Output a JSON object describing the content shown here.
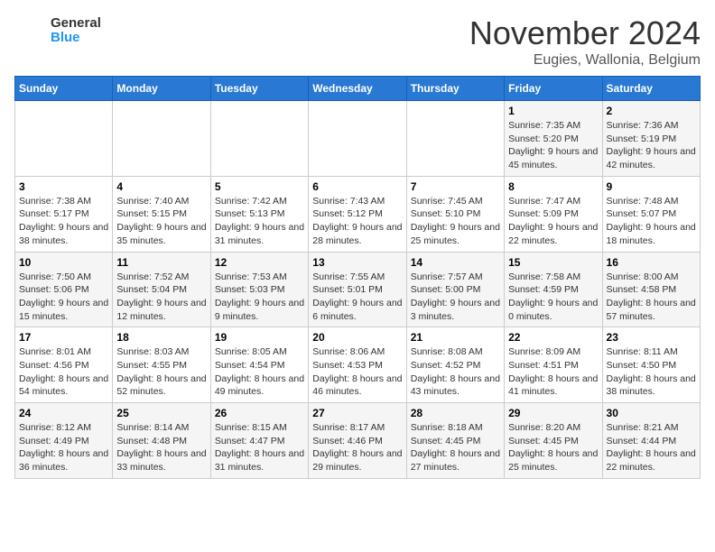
{
  "logo": {
    "line1": "General",
    "line2": "Blue"
  },
  "title": "November 2024",
  "subtitle": "Eugies, Wallonia, Belgium",
  "days_of_week": [
    "Sunday",
    "Monday",
    "Tuesday",
    "Wednesday",
    "Thursday",
    "Friday",
    "Saturday"
  ],
  "weeks": [
    [
      {
        "day": "",
        "info": ""
      },
      {
        "day": "",
        "info": ""
      },
      {
        "day": "",
        "info": ""
      },
      {
        "day": "",
        "info": ""
      },
      {
        "day": "",
        "info": ""
      },
      {
        "day": "1",
        "info": "Sunrise: 7:35 AM\nSunset: 5:20 PM\nDaylight: 9 hours and 45 minutes."
      },
      {
        "day": "2",
        "info": "Sunrise: 7:36 AM\nSunset: 5:19 PM\nDaylight: 9 hours and 42 minutes."
      }
    ],
    [
      {
        "day": "3",
        "info": "Sunrise: 7:38 AM\nSunset: 5:17 PM\nDaylight: 9 hours and 38 minutes."
      },
      {
        "day": "4",
        "info": "Sunrise: 7:40 AM\nSunset: 5:15 PM\nDaylight: 9 hours and 35 minutes."
      },
      {
        "day": "5",
        "info": "Sunrise: 7:42 AM\nSunset: 5:13 PM\nDaylight: 9 hours and 31 minutes."
      },
      {
        "day": "6",
        "info": "Sunrise: 7:43 AM\nSunset: 5:12 PM\nDaylight: 9 hours and 28 minutes."
      },
      {
        "day": "7",
        "info": "Sunrise: 7:45 AM\nSunset: 5:10 PM\nDaylight: 9 hours and 25 minutes."
      },
      {
        "day": "8",
        "info": "Sunrise: 7:47 AM\nSunset: 5:09 PM\nDaylight: 9 hours and 22 minutes."
      },
      {
        "day": "9",
        "info": "Sunrise: 7:48 AM\nSunset: 5:07 PM\nDaylight: 9 hours and 18 minutes."
      }
    ],
    [
      {
        "day": "10",
        "info": "Sunrise: 7:50 AM\nSunset: 5:06 PM\nDaylight: 9 hours and 15 minutes."
      },
      {
        "day": "11",
        "info": "Sunrise: 7:52 AM\nSunset: 5:04 PM\nDaylight: 9 hours and 12 minutes."
      },
      {
        "day": "12",
        "info": "Sunrise: 7:53 AM\nSunset: 5:03 PM\nDaylight: 9 hours and 9 minutes."
      },
      {
        "day": "13",
        "info": "Sunrise: 7:55 AM\nSunset: 5:01 PM\nDaylight: 9 hours and 6 minutes."
      },
      {
        "day": "14",
        "info": "Sunrise: 7:57 AM\nSunset: 5:00 PM\nDaylight: 9 hours and 3 minutes."
      },
      {
        "day": "15",
        "info": "Sunrise: 7:58 AM\nSunset: 4:59 PM\nDaylight: 9 hours and 0 minutes."
      },
      {
        "day": "16",
        "info": "Sunrise: 8:00 AM\nSunset: 4:58 PM\nDaylight: 8 hours and 57 minutes."
      }
    ],
    [
      {
        "day": "17",
        "info": "Sunrise: 8:01 AM\nSunset: 4:56 PM\nDaylight: 8 hours and 54 minutes."
      },
      {
        "day": "18",
        "info": "Sunrise: 8:03 AM\nSunset: 4:55 PM\nDaylight: 8 hours and 52 minutes."
      },
      {
        "day": "19",
        "info": "Sunrise: 8:05 AM\nSunset: 4:54 PM\nDaylight: 8 hours and 49 minutes."
      },
      {
        "day": "20",
        "info": "Sunrise: 8:06 AM\nSunset: 4:53 PM\nDaylight: 8 hours and 46 minutes."
      },
      {
        "day": "21",
        "info": "Sunrise: 8:08 AM\nSunset: 4:52 PM\nDaylight: 8 hours and 43 minutes."
      },
      {
        "day": "22",
        "info": "Sunrise: 8:09 AM\nSunset: 4:51 PM\nDaylight: 8 hours and 41 minutes."
      },
      {
        "day": "23",
        "info": "Sunrise: 8:11 AM\nSunset: 4:50 PM\nDaylight: 8 hours and 38 minutes."
      }
    ],
    [
      {
        "day": "24",
        "info": "Sunrise: 8:12 AM\nSunset: 4:49 PM\nDaylight: 8 hours and 36 minutes."
      },
      {
        "day": "25",
        "info": "Sunrise: 8:14 AM\nSunset: 4:48 PM\nDaylight: 8 hours and 33 minutes."
      },
      {
        "day": "26",
        "info": "Sunrise: 8:15 AM\nSunset: 4:47 PM\nDaylight: 8 hours and 31 minutes."
      },
      {
        "day": "27",
        "info": "Sunrise: 8:17 AM\nSunset: 4:46 PM\nDaylight: 8 hours and 29 minutes."
      },
      {
        "day": "28",
        "info": "Sunrise: 8:18 AM\nSunset: 4:45 PM\nDaylight: 8 hours and 27 minutes."
      },
      {
        "day": "29",
        "info": "Sunrise: 8:20 AM\nSunset: 4:45 PM\nDaylight: 8 hours and 25 minutes."
      },
      {
        "day": "30",
        "info": "Sunrise: 8:21 AM\nSunset: 4:44 PM\nDaylight: 8 hours and 22 minutes."
      }
    ]
  ]
}
